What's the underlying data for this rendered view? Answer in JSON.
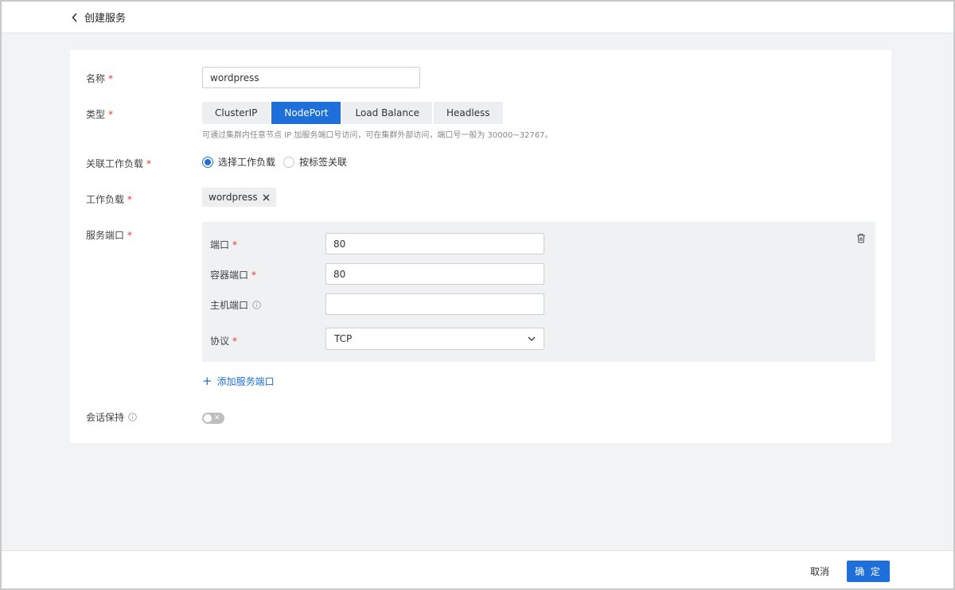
{
  "header": {
    "back_label": "创建服务"
  },
  "form": {
    "name": {
      "label": "名称",
      "value": "wordpress"
    },
    "type": {
      "label": "类型",
      "options": [
        "ClusterIP",
        "NodePort",
        "Load Balance",
        "Headless"
      ],
      "selected": "NodePort",
      "hint": "可通过集群内任意节点 IP 加服务端口号访问，可在集群外部访问，端口号一般为 30000~32767。"
    },
    "workload_binding": {
      "label": "关联工作负载",
      "options": [
        "选择工作负载",
        "按标签关联"
      ],
      "selected": "选择工作负载"
    },
    "workload": {
      "label": "工作负载",
      "tag": "wordpress"
    },
    "service_port": {
      "label": "服务端口",
      "port": {
        "label": "端口",
        "value": "80"
      },
      "container_port": {
        "label": "容器端口",
        "value": "80"
      },
      "host_port": {
        "label": "主机端口",
        "value": ""
      },
      "protocol": {
        "label": "协议",
        "value": "TCP"
      },
      "add_label": "添加服务端口"
    },
    "session_affinity": {
      "label": "会话保持",
      "enabled": false
    }
  },
  "footer": {
    "cancel_label": "取消",
    "confirm_label": "确 定"
  },
  "colors": {
    "primary": "#1e6fd9",
    "required": "#e53935"
  }
}
